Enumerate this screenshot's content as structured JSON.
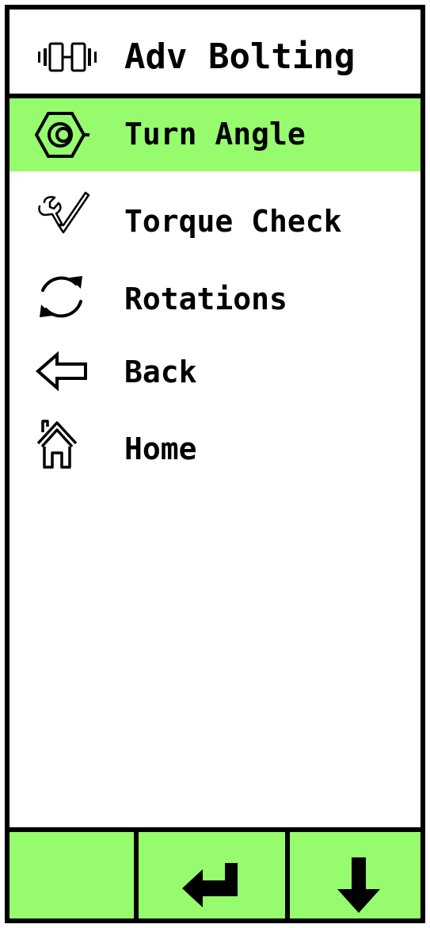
{
  "theme": {
    "accent": "#96fc6e",
    "ink": "#000000"
  },
  "header": {
    "title": "Adv Bolting",
    "icon": "bolting-tool-icon"
  },
  "menu": {
    "items": [
      {
        "label": "Turn Angle",
        "icon": "hex-nut-icon",
        "selected": true
      },
      {
        "label": "Torque Check",
        "icon": "wrench-check-icon",
        "selected": false
      },
      {
        "label": "Rotations",
        "icon": "rotate-arrows-icon",
        "selected": false
      },
      {
        "label": "Back",
        "icon": "back-arrow-icon",
        "selected": false
      },
      {
        "label": "Home",
        "icon": "home-icon",
        "selected": false
      }
    ]
  },
  "softkeys": [
    {
      "name": "empty-softkey",
      "icon": ""
    },
    {
      "name": "enter-softkey",
      "icon": "enter-arrow-icon"
    },
    {
      "name": "down-softkey",
      "icon": "down-arrow-icon"
    }
  ]
}
